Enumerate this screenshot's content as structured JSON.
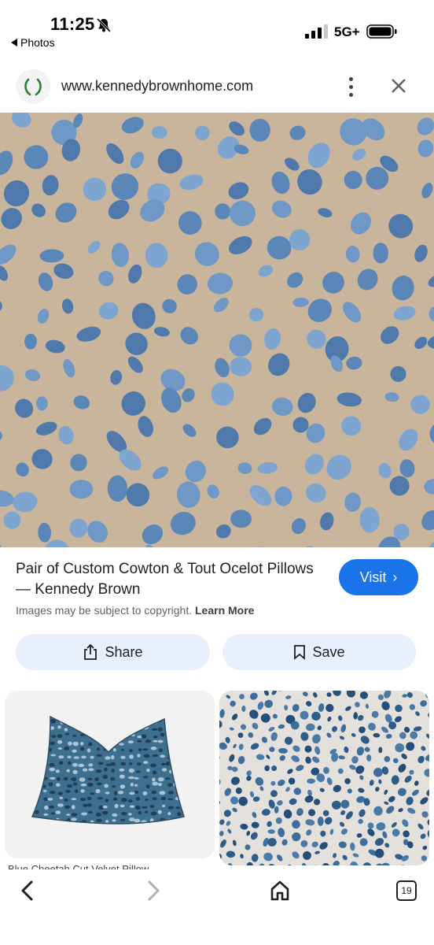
{
  "status_bar": {
    "time": "11:25",
    "back_app": "Photos",
    "network": "5G+"
  },
  "browser": {
    "url": "www.kennedybrownhome.com"
  },
  "result": {
    "title": "Pair of Custom Cowton & Tout Ocelot Pillows — Kennedy Brown",
    "visit_label": "Visit",
    "copyright_text": "Images may be subject to copyright.",
    "learn_more": "Learn More",
    "share_label": "Share",
    "save_label": "Save"
  },
  "related": {
    "caption": "Blue Cheetah Cut Velvet Pillow"
  },
  "bottom_nav": {
    "tab_count": "19"
  },
  "icons": [
    "bell-slash-icon",
    "signal-icon",
    "battery-icon",
    "laurel-logo-icon",
    "more-vert-icon",
    "close-icon",
    "share-icon",
    "bookmark-icon",
    "chevron-left-icon",
    "chevron-right-icon",
    "home-icon",
    "tabs-icon"
  ],
  "colors": {
    "accent": "#1a73e8",
    "button_bg": "#e8f0fe",
    "fabric_base": "#c9b59c",
    "spot_blue": "#5b86b8"
  }
}
